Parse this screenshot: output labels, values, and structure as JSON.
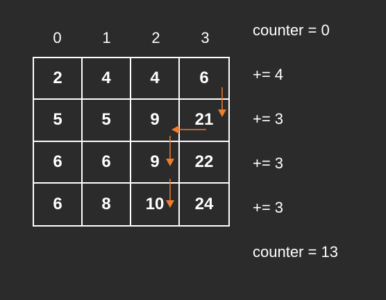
{
  "columns": [
    "0",
    "1",
    "2",
    "3"
  ],
  "matrix": [
    [
      "2",
      "4",
      "4",
      "6"
    ],
    [
      "5",
      "5",
      "9",
      "21"
    ],
    [
      "6",
      "6",
      "9",
      "22"
    ],
    [
      "6",
      "8",
      "10",
      "24"
    ]
  ],
  "notes": {
    "counter_start": "counter = 0",
    "row1": "+= 4",
    "row2": "+= 3",
    "row3": "+= 3",
    "row4": "+= 3",
    "counter_end": "counter = 13"
  },
  "colors": {
    "background": "#2b2b2b",
    "grid_and_text": "#ffffff",
    "arrow": "#ed7d31"
  }
}
